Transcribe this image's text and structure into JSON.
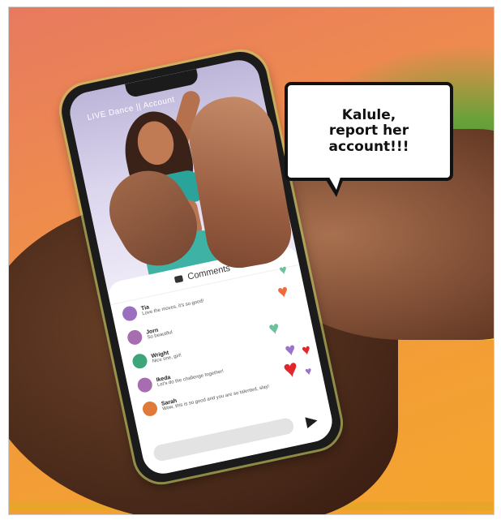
{
  "speech_bubble": {
    "text": "Kalule,\nreport her\naccount!!!"
  },
  "phone": {
    "live_header": "LIVE  Dance  ||  Account",
    "comments_header": "Comments",
    "comments": [
      {
        "name": "Tia",
        "text": "Love the moves, it's so good!",
        "avatar_color": "#9b6fc0"
      },
      {
        "name": "Jorn",
        "text": "So beautiful",
        "avatar_color": "#a66db0"
      },
      {
        "name": "Wright",
        "text": "Nice one, girl!",
        "avatar_color": "#3da57a"
      },
      {
        "name": "Ikeda",
        "text": "Let's do the challenge together!",
        "avatar_color": "#a66db0"
      },
      {
        "name": "Sarah",
        "text": "Wow, this is so good and you are so talented, slay!",
        "avatar_color": "#e07a3a"
      }
    ]
  },
  "colors": {
    "heart_red": "#e2262b",
    "heart_purple": "#9a74c8",
    "heart_green": "#6cc29a",
    "heart_orange": "#f06a3a",
    "heart_pink": "#e85b7a"
  }
}
